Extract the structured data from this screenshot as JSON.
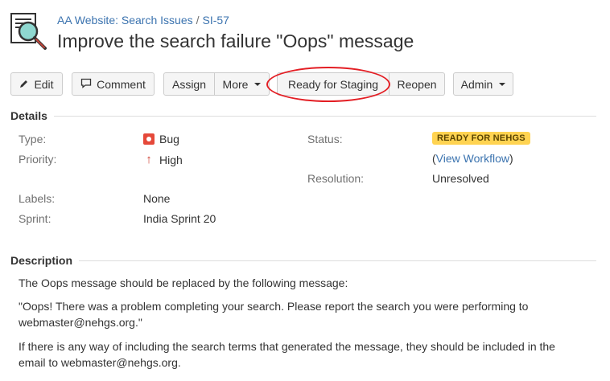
{
  "header": {
    "project": "AA Website: Search Issues",
    "separator": "/",
    "issue_key": "SI-57",
    "title": "Improve the search failure \"Oops\" message"
  },
  "toolbar": {
    "edit": "Edit",
    "comment": "Comment",
    "assign": "Assign",
    "more": "More",
    "ready_for_staging": "Ready for Staging",
    "reopen": "Reopen",
    "admin": "Admin"
  },
  "details": {
    "heading": "Details",
    "type_label": "Type:",
    "type_value": "Bug",
    "priority_label": "Priority:",
    "priority_value": "High",
    "labels_label": "Labels:",
    "labels_value": "None",
    "sprint_label": "Sprint:",
    "sprint_value": "India Sprint 20",
    "status_label": "Status:",
    "status_value": "READY FOR NEHGS",
    "workflow_open": "(",
    "workflow_link": "View Workflow",
    "workflow_close": ")",
    "resolution_label": "Resolution:",
    "resolution_value": "Unresolved"
  },
  "description": {
    "heading": "Description",
    "p1": "The Oops message should be replaced by the following message:",
    "p2_line1": "\"Oops! There was a problem completing your search. Please report the search you were performing to",
    "p2_line2": "webmaster@nehgs.org.\"",
    "p3_line1": "If there is any way of including the search terms that generated the message, they should be included in the",
    "p3_line2": "email to webmaster@nehgs.org."
  },
  "colors": {
    "link": "#3b73af",
    "status_lozenge": "#ffd351",
    "highlight": "#e31e24",
    "bug": "#e5493a"
  },
  "icons": {
    "avatar": "magnifier-document-icon",
    "edit": "pencil-icon",
    "comment": "speech-bubble-icon",
    "type": "bug-icon",
    "priority": "arrow-up-icon"
  }
}
